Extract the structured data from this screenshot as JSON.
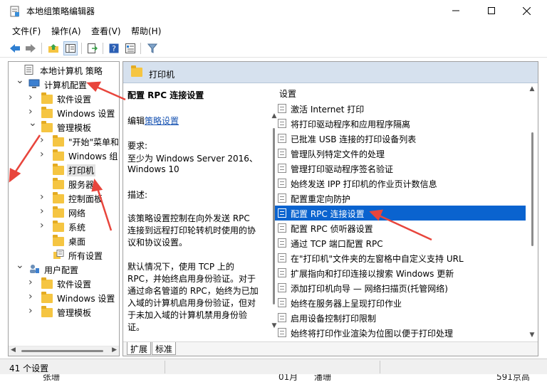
{
  "window": {
    "title": "本地组策略编辑器",
    "controls": {
      "minimize": "minimize",
      "maximize": "maximize",
      "close": "close"
    }
  },
  "menu": [
    {
      "label": "文件(F)"
    },
    {
      "label": "操作(A)"
    },
    {
      "label": "查看(V)"
    },
    {
      "label": "帮助(H)"
    }
  ],
  "toolbar": {
    "icons": [
      "back-arrow-icon",
      "forward-arrow-icon",
      "up-folder-icon",
      "show-hide-tree-icon",
      "export-list-icon",
      "help-icon",
      "properties-icon",
      "filter-icon"
    ]
  },
  "tree": {
    "items": [
      {
        "label": "本地计算机 策略",
        "level": 0,
        "expand": "",
        "icon": "policy-doc-icon"
      },
      {
        "label": "计算机配置",
        "level": 1,
        "expand": "down",
        "icon": "computer-icon"
      },
      {
        "label": "软件设置",
        "level": 2,
        "expand": "right",
        "icon": "folder-icon"
      },
      {
        "label": "Windows 设置",
        "level": 2,
        "expand": "right",
        "icon": "folder-icon"
      },
      {
        "label": "管理模板",
        "level": 2,
        "expand": "down",
        "icon": "folder-icon"
      },
      {
        "label": "\"开始\"菜单和",
        "level": 3,
        "expand": "right",
        "icon": "folder-icon"
      },
      {
        "label": "Windows 组",
        "level": 3,
        "expand": "right",
        "icon": "folder-icon"
      },
      {
        "label": "打印机",
        "level": 3,
        "expand": "",
        "icon": "folder-icon",
        "selected": true
      },
      {
        "label": "服务器",
        "level": 3,
        "expand": "",
        "icon": "folder-icon"
      },
      {
        "label": "控制面板",
        "level": 3,
        "expand": "right",
        "icon": "folder-icon"
      },
      {
        "label": "网络",
        "level": 3,
        "expand": "right",
        "icon": "folder-icon"
      },
      {
        "label": "系统",
        "level": 3,
        "expand": "right",
        "icon": "folder-icon"
      },
      {
        "label": "桌面",
        "level": 3,
        "expand": "",
        "icon": "folder-icon"
      },
      {
        "label": "所有设置",
        "level": 3,
        "expand": "",
        "icon": "all-settings-icon"
      },
      {
        "label": "用户配置",
        "level": 1,
        "expand": "down",
        "icon": "user-icon"
      },
      {
        "label": "软件设置",
        "level": 2,
        "expand": "right",
        "icon": "folder-icon"
      },
      {
        "label": "Windows 设置",
        "level": 2,
        "expand": "right",
        "icon": "folder-icon"
      },
      {
        "label": "管理模板",
        "level": 2,
        "expand": "right",
        "icon": "folder-icon"
      }
    ]
  },
  "right": {
    "header": "打印机",
    "desc": {
      "title": "配置 RPC 连接设置",
      "edit_prefix": "编辑",
      "edit_link": "策略设置",
      "req_label": "要求:",
      "req_line1": "至少为 Windows Server 2016、",
      "req_line2": "Windows 10",
      "desc_label": "描述:",
      "p1_l1": "该策略设置控制在向外发送 RPC",
      "p1_l2": "连接到远程打印轮转机时使用的协",
      "p1_l3": "议和协议设置。",
      "p2_l1": "默认情况下，使用 TCP 上的",
      "p2_l2": "RPC，并始终启用身份验证。对于",
      "p2_l3": "通过命名管道的 RPC，始终为已加",
      "p2_l4": "入域的计算机启用身份验证，但对",
      "p2_l5": "于未加入域的计算机禁用身份验",
      "p2_l6": "证。"
    },
    "list_header": "设置",
    "settings": [
      "激活 Internet 打印",
      "将打印驱动程序和应用程序隔离",
      "已批准 USB 连接的打印设备列表",
      "管理队列特定文件的处理",
      "管理打印驱动程序签名验证",
      "始终发送 IPP 打印机的作业页计数信息",
      "配置重定向防护",
      "配置 RPC 连接设置",
      "配置 RPC 侦听器设置",
      "通过 TCP 端口配置 RPC",
      "在\"打印机\"文件夹的左窗格中自定义支持 URL",
      "扩展指向和打印连接以搜索 Windows 更新",
      "添加打印机向导 — 网络扫描页(托管网络)",
      "始终在服务器上呈现打印作业",
      "启用设备控制打印限制",
      "始终将打印作业渲染为位图以便于打印处理"
    ],
    "selected_index": 7,
    "tabs": [
      "扩展",
      "标准"
    ]
  },
  "status": {
    "text": "41 个设置"
  },
  "behind": {
    "left": "张珊",
    "mid1": "01月",
    "mid2": "潘珊",
    "right": "591京高"
  },
  "colors": {
    "selection": "#0a63cf",
    "header_bg": "#d6e1ee",
    "arrow": "#e8453c",
    "link": "#1a55b3"
  }
}
